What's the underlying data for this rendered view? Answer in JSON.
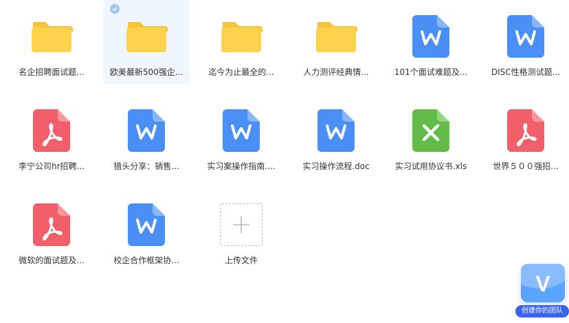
{
  "files": [
    {
      "name": "名企招聘面试题...",
      "type": "folder",
      "selected": false
    },
    {
      "name": "欧美最新500强企...",
      "type": "folder",
      "selected": true
    },
    {
      "name": "迄今为止最全的...",
      "type": "folder",
      "selected": false
    },
    {
      "name": "人力测评经典情...",
      "type": "folder",
      "selected": false
    },
    {
      "name": "101个面试难题及...",
      "type": "word",
      "selected": false
    },
    {
      "name": "DISC性格测试题...",
      "type": "word",
      "selected": false
    },
    {
      "name": "李宁公司hr招聘...",
      "type": "pdf",
      "selected": false
    },
    {
      "name": "猎头分享：销售...",
      "type": "word",
      "selected": false
    },
    {
      "name": "实习案操作指南....",
      "type": "word",
      "selected": false
    },
    {
      "name": "实习操作流程.doc",
      "type": "word",
      "selected": false
    },
    {
      "name": "实习试用协议书.xls",
      "type": "excel",
      "selected": false
    },
    {
      "name": "世界５００强招...",
      "type": "pdf",
      "selected": false
    },
    {
      "name": "微软的面试题及...",
      "type": "pdf",
      "selected": false
    },
    {
      "name": "校企合作框架协...",
      "type": "word",
      "selected": false
    }
  ],
  "upload": {
    "label": "上传文件"
  },
  "badge": {
    "letter": "V",
    "label": "创建你的团队"
  },
  "colors": {
    "folder": "#fdd24c",
    "word": "#4a8ff5",
    "pdf": "#f1606a",
    "excel": "#62bd48",
    "selected_bg": "#f0f6fd"
  }
}
